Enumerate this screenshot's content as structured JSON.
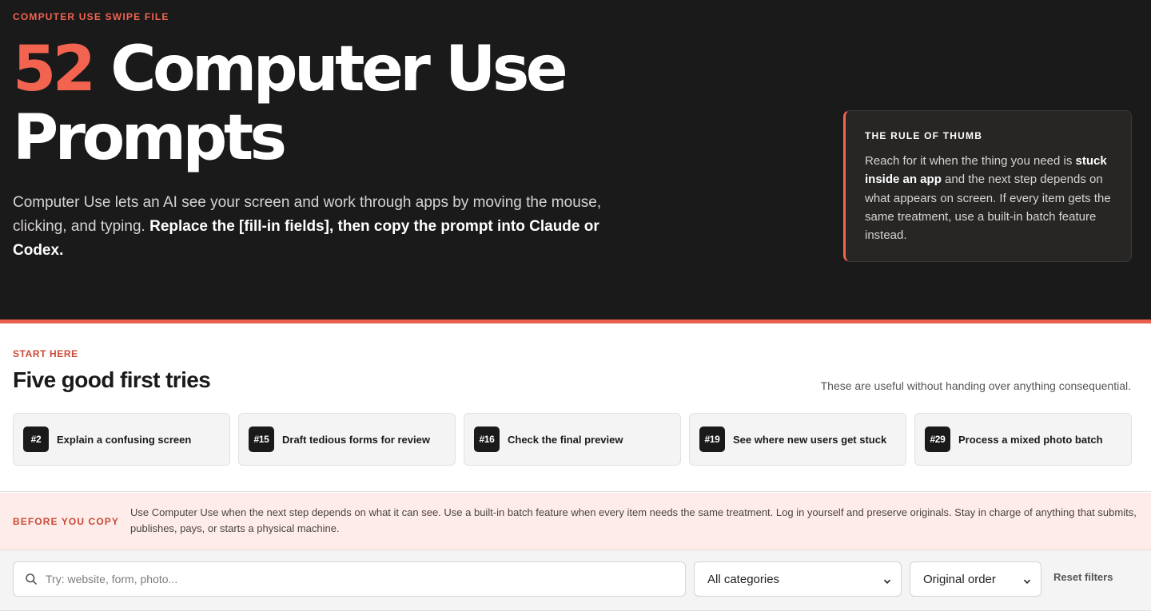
{
  "hero": {
    "eyebrow": "COMPUTER USE SWIPE FILE",
    "count": "52",
    "title_rest": "Computer Use Prompts",
    "lede_plain": "Computer Use lets an AI see your screen and work through apps by moving the mouse, clicking, and typing.",
    "lede_bold": "Replace the [fill-in fields], then copy the prompt into Claude or Codex.",
    "accent_color": "#f26450"
  },
  "rule_card": {
    "title": "THE RULE OF THUMB",
    "body_1": "Reach for it when the thing you need is",
    "body_bold": "stuck inside an app",
    "body_2": "and the next step depends on what appears on screen. If every item gets the same treatment, use a built-in batch feature instead."
  },
  "start": {
    "eyebrow": "START HERE",
    "title": "Five good first tries",
    "note": "These are useful without handing over anything consequential.",
    "items": [
      {
        "num": "#2",
        "label": "Explain a confusing screen"
      },
      {
        "num": "#15",
        "label": "Draft tedious forms for review"
      },
      {
        "num": "#16",
        "label": "Check the final preview"
      },
      {
        "num": "#19",
        "label": "See where new users get stuck"
      },
      {
        "num": "#29",
        "label": "Process a mixed photo batch"
      }
    ]
  },
  "before": {
    "label": "BEFORE YOU COPY",
    "text": "Use Computer Use when the next step depends on what it can see. Use a built-in batch feature when every item needs the same treatment. Log in yourself and preserve originals. Stay in charge of anything that submits, publishes, pays, or starts a physical machine."
  },
  "filters": {
    "search_placeholder": "Try: website, form, photo...",
    "search_icon": "search-icon",
    "category_selected": "All categories",
    "order_selected": "Original order",
    "reset_label": "Reset filters"
  }
}
